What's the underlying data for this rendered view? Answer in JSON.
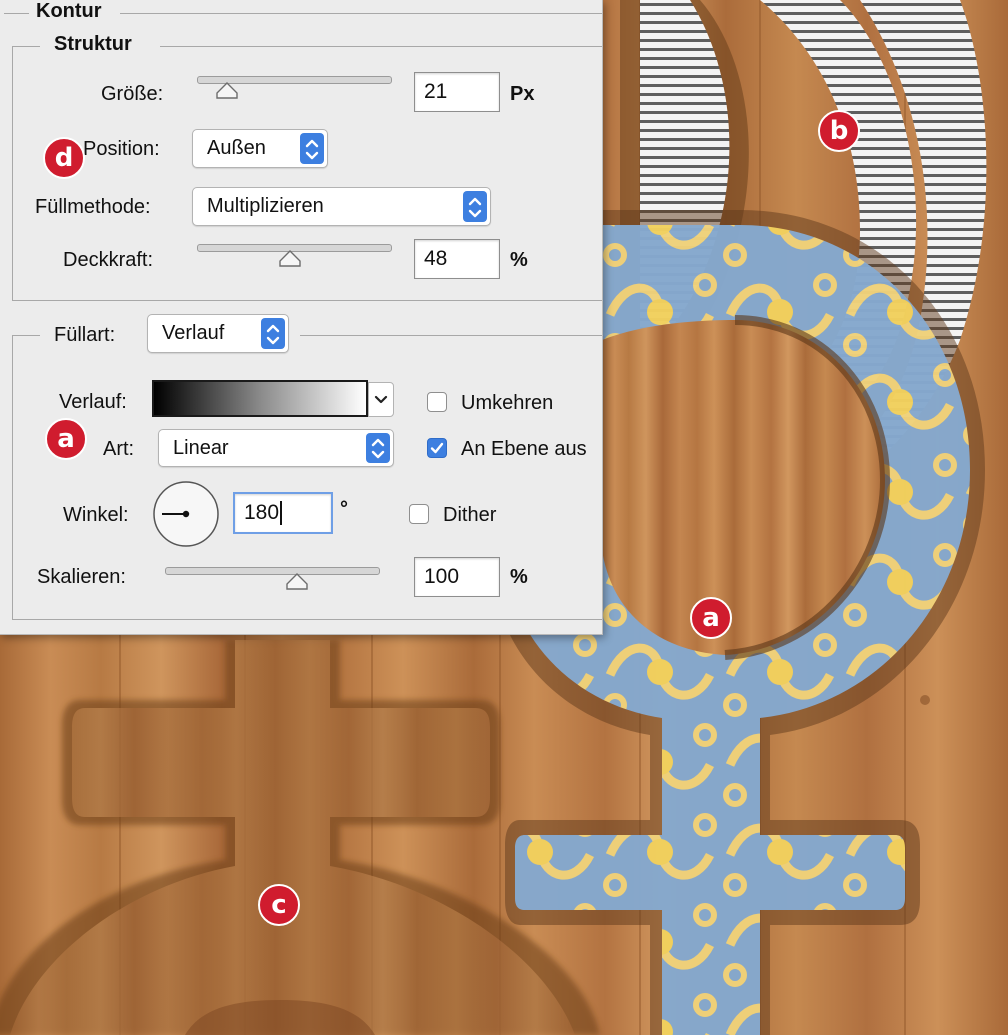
{
  "panel": {
    "group_title": "Kontur",
    "structure_title": "Struktur",
    "size": {
      "label": "Größe:",
      "value": "21",
      "unit": "Px",
      "slider_fraction": 0.13
    },
    "position": {
      "label": "Position:",
      "value": "Außen"
    },
    "blend_mode": {
      "label": "Füllmethode:",
      "value": "Multiplizieren"
    },
    "opacity": {
      "label": "Deckkraft:",
      "value": "48",
      "unit": "%",
      "slider_fraction": 0.48
    },
    "fill_type": {
      "label": "Füllart:",
      "value": "Verlauf"
    },
    "gradient": {
      "label": "Verlauf:"
    },
    "reverse": {
      "label": "Umkehren",
      "checked": false
    },
    "style": {
      "label": "Art:",
      "value": "Linear"
    },
    "align_with_layer": {
      "label": "An Ebene aus",
      "checked": true
    },
    "angle": {
      "label": "Winkel:",
      "value": "180",
      "unit": "°"
    },
    "dither": {
      "label": "Dither",
      "checked": false
    },
    "scale": {
      "label": "Skalieren:",
      "value": "100",
      "unit": "%",
      "slider_fraction": 0.6
    }
  },
  "callouts": [
    "a",
    "b",
    "c",
    "d",
    "a"
  ],
  "colors": {
    "panel_bg": "#ececec",
    "accent": "#3d7fe0",
    "badge": "#d01c2e",
    "wood": "#b87a45",
    "pattern_blue": "#7fa6cf",
    "pattern_gold": "#f2d27a"
  }
}
